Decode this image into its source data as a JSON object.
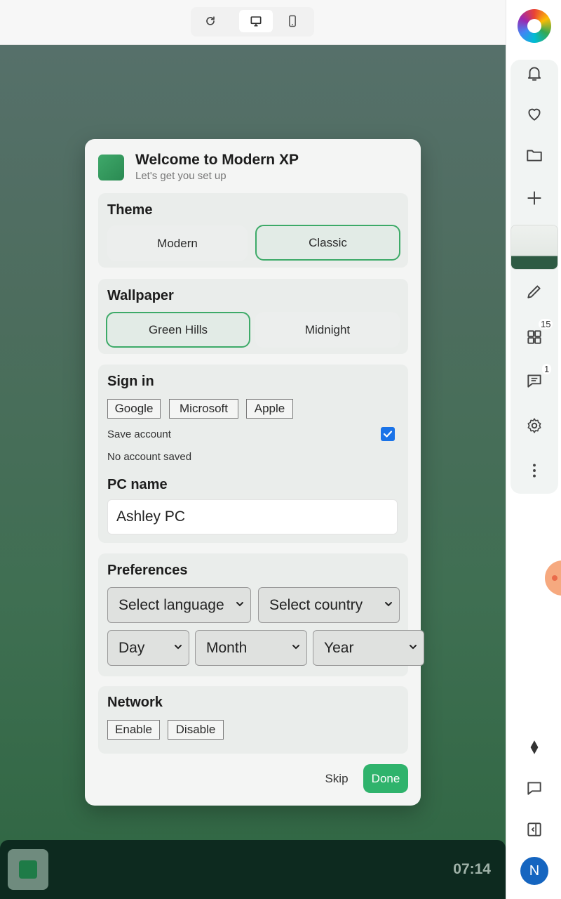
{
  "toolbar": {
    "reload_icon": "reload-icon",
    "desktop_icon": "desktop-icon",
    "mobile_icon": "mobile-icon"
  },
  "dialog": {
    "title": "Welcome to Modern XP",
    "subtitle": "Let's get you set up",
    "theme": {
      "heading": "Theme",
      "options": [
        "Modern",
        "Classic"
      ],
      "selected": "Classic"
    },
    "wallpaper": {
      "heading": "Wallpaper",
      "options": [
        "Green Hills",
        "Midnight"
      ],
      "selected": "Green Hills"
    },
    "signin": {
      "heading": "Sign in",
      "providers": [
        "Google",
        "Microsoft",
        "Apple"
      ],
      "save_account_label": "Save account",
      "save_account_checked": true,
      "status": "No account saved"
    },
    "pc_name": {
      "heading": "PC name",
      "value": "Ashley PC"
    },
    "preferences": {
      "heading": "Preferences",
      "language": "Select language",
      "country": "Select country",
      "day": "Day",
      "month": "Month",
      "year": "Year"
    },
    "network": {
      "heading": "Network",
      "enable": "Enable",
      "disable": "Disable"
    },
    "skip_label": "Skip",
    "done_label": "Done"
  },
  "taskbar": {
    "clock": "07:14"
  },
  "sidebar": {
    "apps_badge": "15",
    "messages_badge": "1",
    "avatar_letter": "N"
  },
  "colors": {
    "accent": "#2fb36c",
    "checkbox": "#1a73e8",
    "taskbar": "#0d2a1f"
  }
}
